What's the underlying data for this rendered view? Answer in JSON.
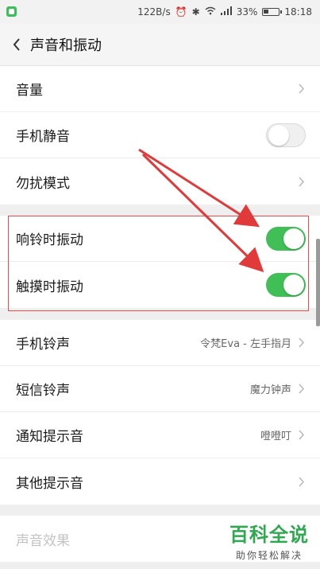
{
  "status_bar": {
    "speed": "122B/s",
    "battery_pct": "33%",
    "time": "18:18"
  },
  "header": {
    "title": "声音和振动"
  },
  "group1": [
    {
      "label": "音量",
      "control": "chevron"
    },
    {
      "label": "手机静音",
      "control": "toggle",
      "on": false
    },
    {
      "label": "勿扰模式",
      "control": "chevron"
    }
  ],
  "group2": [
    {
      "label": "响铃时振动",
      "control": "toggle",
      "on": true
    },
    {
      "label": "触摸时振动",
      "control": "toggle",
      "on": true
    }
  ],
  "group3": [
    {
      "label": "手机铃声",
      "value": "令梵Eva - 左手指月"
    },
    {
      "label": "短信铃声",
      "value": "魔力钟声"
    },
    {
      "label": "通知提示音",
      "value": "噔噔叮"
    },
    {
      "label": "其他提示音",
      "value": ""
    }
  ],
  "group4": [
    {
      "label": "声音效果",
      "disabled": true
    }
  ],
  "watermark": {
    "main": "百科全说",
    "sub": "助你轻松解决"
  },
  "colors": {
    "toggle_on": "#3fbf55",
    "highlight": "#e05050",
    "watermark": "#2fa84f"
  }
}
